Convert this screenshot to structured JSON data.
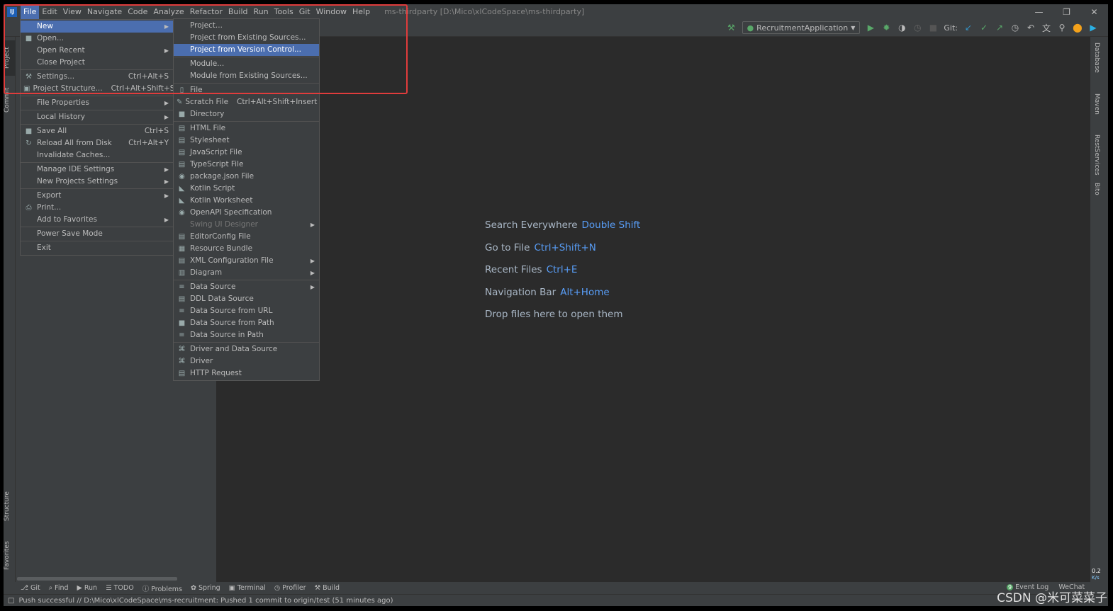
{
  "window": {
    "title": "ms-thirdparty [D:\\Mico\\xlCodeSpace\\ms-thirdparty]",
    "logo": "IJ"
  },
  "menubar": [
    "File",
    "Edit",
    "View",
    "Navigate",
    "Code",
    "Analyze",
    "Refactor",
    "Build",
    "Run",
    "Tools",
    "Git",
    "Window",
    "Help"
  ],
  "toolbar": {
    "run_config": "RecruitmentApplication",
    "git_label": "Git:"
  },
  "left_tabs": [
    "Project",
    "Commit",
    "Structure",
    "Favorites"
  ],
  "right_tabs": [
    "Database",
    "Maven",
    "RestServices",
    "Bito"
  ],
  "file_menu": [
    {
      "label": "New",
      "arrow": true,
      "selected": true
    },
    {
      "label": "Open...",
      "icon": "folder-icon"
    },
    {
      "label": "Open Recent",
      "arrow": true
    },
    {
      "label": "Close Project"
    },
    {
      "sep": true
    },
    {
      "label": "Settings...",
      "shortcut": "Ctrl+Alt+S",
      "icon": "wrench-icon"
    },
    {
      "label": "Project Structure...",
      "shortcut": "Ctrl+Alt+Shift+S",
      "icon": "project-structure-icon"
    },
    {
      "sep": true
    },
    {
      "label": "File Properties",
      "arrow": true
    },
    {
      "sep": true
    },
    {
      "label": "Local History",
      "arrow": true
    },
    {
      "sep": true
    },
    {
      "label": "Save All",
      "shortcut": "Ctrl+S",
      "icon": "save-icon"
    },
    {
      "label": "Reload All from Disk",
      "shortcut": "Ctrl+Alt+Y",
      "icon": "reload-icon"
    },
    {
      "label": "Invalidate Caches..."
    },
    {
      "sep": true
    },
    {
      "label": "Manage IDE Settings",
      "arrow": true
    },
    {
      "label": "New Projects Settings",
      "arrow": true
    },
    {
      "sep": true
    },
    {
      "label": "Export",
      "arrow": true
    },
    {
      "label": "Print...",
      "icon": "print-icon"
    },
    {
      "label": "Add to Favorites",
      "arrow": true
    },
    {
      "sep": true
    },
    {
      "label": "Power Save Mode"
    },
    {
      "sep": true
    },
    {
      "label": "Exit"
    }
  ],
  "new_submenu": [
    {
      "label": "Project..."
    },
    {
      "label": "Project from Existing Sources..."
    },
    {
      "label": "Project from Version Control...",
      "selected": true
    },
    {
      "sep": true
    },
    {
      "label": "Module..."
    },
    {
      "label": "Module from Existing Sources..."
    },
    {
      "sep": true
    },
    {
      "label": "File",
      "icon": "file-icon"
    },
    {
      "label": "Scratch File",
      "shortcut": "Ctrl+Alt+Shift+Insert",
      "icon": "scratch-file-icon"
    },
    {
      "label": "Directory",
      "icon": "folder-icon"
    },
    {
      "sep": true
    },
    {
      "label": "HTML File",
      "icon": "html-icon"
    },
    {
      "label": "Stylesheet",
      "icon": "css-icon"
    },
    {
      "label": "JavaScript File",
      "icon": "js-icon"
    },
    {
      "label": "TypeScript File",
      "icon": "ts-icon"
    },
    {
      "label": "package.json File",
      "icon": "npm-icon"
    },
    {
      "label": "Kotlin Script",
      "icon": "kotlin-icon"
    },
    {
      "label": "Kotlin Worksheet",
      "icon": "kotlin-icon"
    },
    {
      "label": "OpenAPI Specification",
      "icon": "openapi-icon"
    },
    {
      "label": "Swing UI Designer",
      "arrow": true,
      "disabled": true
    },
    {
      "label": "EditorConfig File",
      "icon": "editorconfig-icon"
    },
    {
      "label": "Resource Bundle",
      "icon": "resource-bundle-icon"
    },
    {
      "label": "XML Configuration File",
      "arrow": true,
      "icon": "xml-icon"
    },
    {
      "label": "Diagram",
      "arrow": true,
      "icon": "diagram-icon"
    },
    {
      "sep": true
    },
    {
      "label": "Data Source",
      "arrow": true,
      "icon": "database-icon"
    },
    {
      "label": "DDL Data Source",
      "icon": "ddl-icon"
    },
    {
      "label": "Data Source from URL",
      "icon": "database-url-icon"
    },
    {
      "label": "Data Source from Path",
      "icon": "database-folder-icon"
    },
    {
      "label": "Data Source in Path",
      "icon": "database-icon"
    },
    {
      "sep": true
    },
    {
      "label": "Driver and Data Source",
      "icon": "driver-icon"
    },
    {
      "label": "Driver",
      "icon": "driver-icon"
    },
    {
      "label": "HTTP Request",
      "icon": "api-icon"
    }
  ],
  "editor_hints": [
    {
      "text": "Search Everywhere",
      "key": "Double Shift"
    },
    {
      "text": "Go to File",
      "key": "Ctrl+Shift+N"
    },
    {
      "text": "Recent Files",
      "key": "Ctrl+E"
    },
    {
      "text": "Navigation Bar",
      "key": "Alt+Home"
    },
    {
      "text": "Drop files here to open them",
      "key": ""
    }
  ],
  "bottom_tools": [
    "Git",
    "Find",
    "Run",
    "TODO",
    "Problems",
    "Spring",
    "Terminal",
    "Profiler",
    "Build"
  ],
  "bottom_right": {
    "event_log": "Event Log",
    "event_count": "9",
    "wechat": "WeChat"
  },
  "net_speed": {
    "value": "0.2",
    "unit": "K/s"
  },
  "status": "Push successful // D:\\Mico\\xlCodeSpace\\ms-recruitment: Pushed 1 commit to origin/test (51 minutes ago)",
  "watermark": "CSDN @米可菜菜子",
  "colors": {
    "accent": "#4b6eaf",
    "link": "#589df6",
    "highlight_box": "#e03c3c"
  }
}
